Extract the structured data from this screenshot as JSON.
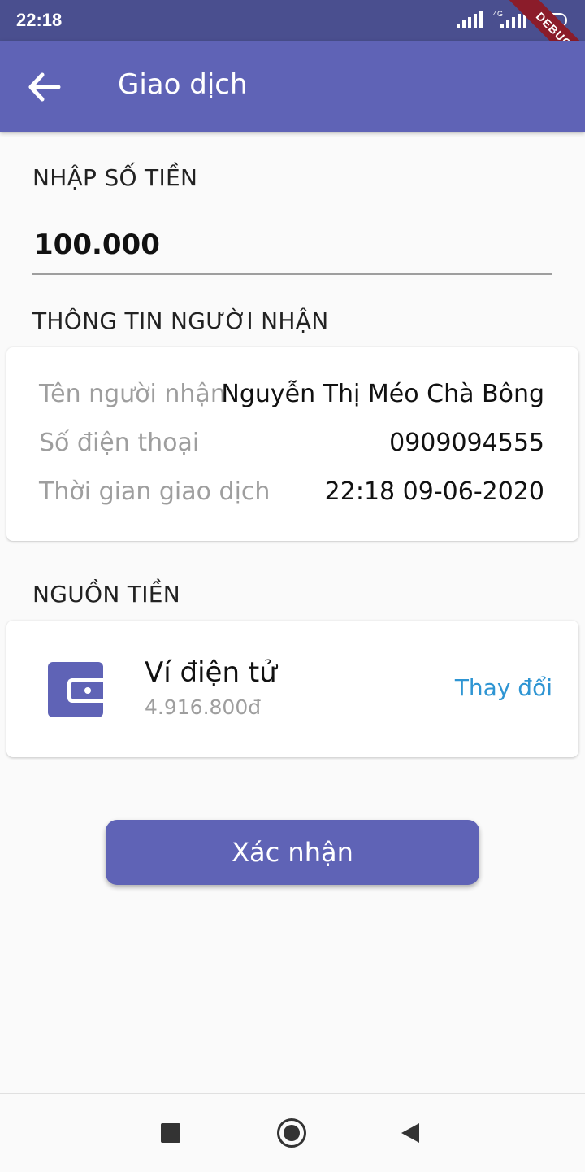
{
  "status_bar": {
    "time": "22:18",
    "network": "4G",
    "battery": "62",
    "debug": "DEBUG"
  },
  "app_bar": {
    "title": "Giao dịch"
  },
  "amount": {
    "label": "NHẬP SỐ TIỀN",
    "value": "100.000"
  },
  "recipient": {
    "section_label": "THÔNG TIN NGƯỜI NHẬN",
    "rows": [
      {
        "label": "Tên người nhận",
        "value": "Nguyễn Thị Méo Chà Bông"
      },
      {
        "label": "Số điện thoại",
        "value": "0909094555"
      },
      {
        "label": "Thời gian giao dịch",
        "value": "22:18 09-06-2020"
      }
    ]
  },
  "source": {
    "section_label": "NGUỒN TIỀN",
    "wallet_name": "Ví điện tử",
    "balance": "4.916.800đ",
    "change_label": "Thay đổi",
    "icon": "wallet-icon"
  },
  "confirm_label": "Xác nhận",
  "colors": {
    "primary": "#5f63b6",
    "status_bar": "#4a4f8f",
    "link": "#2e95d3"
  }
}
